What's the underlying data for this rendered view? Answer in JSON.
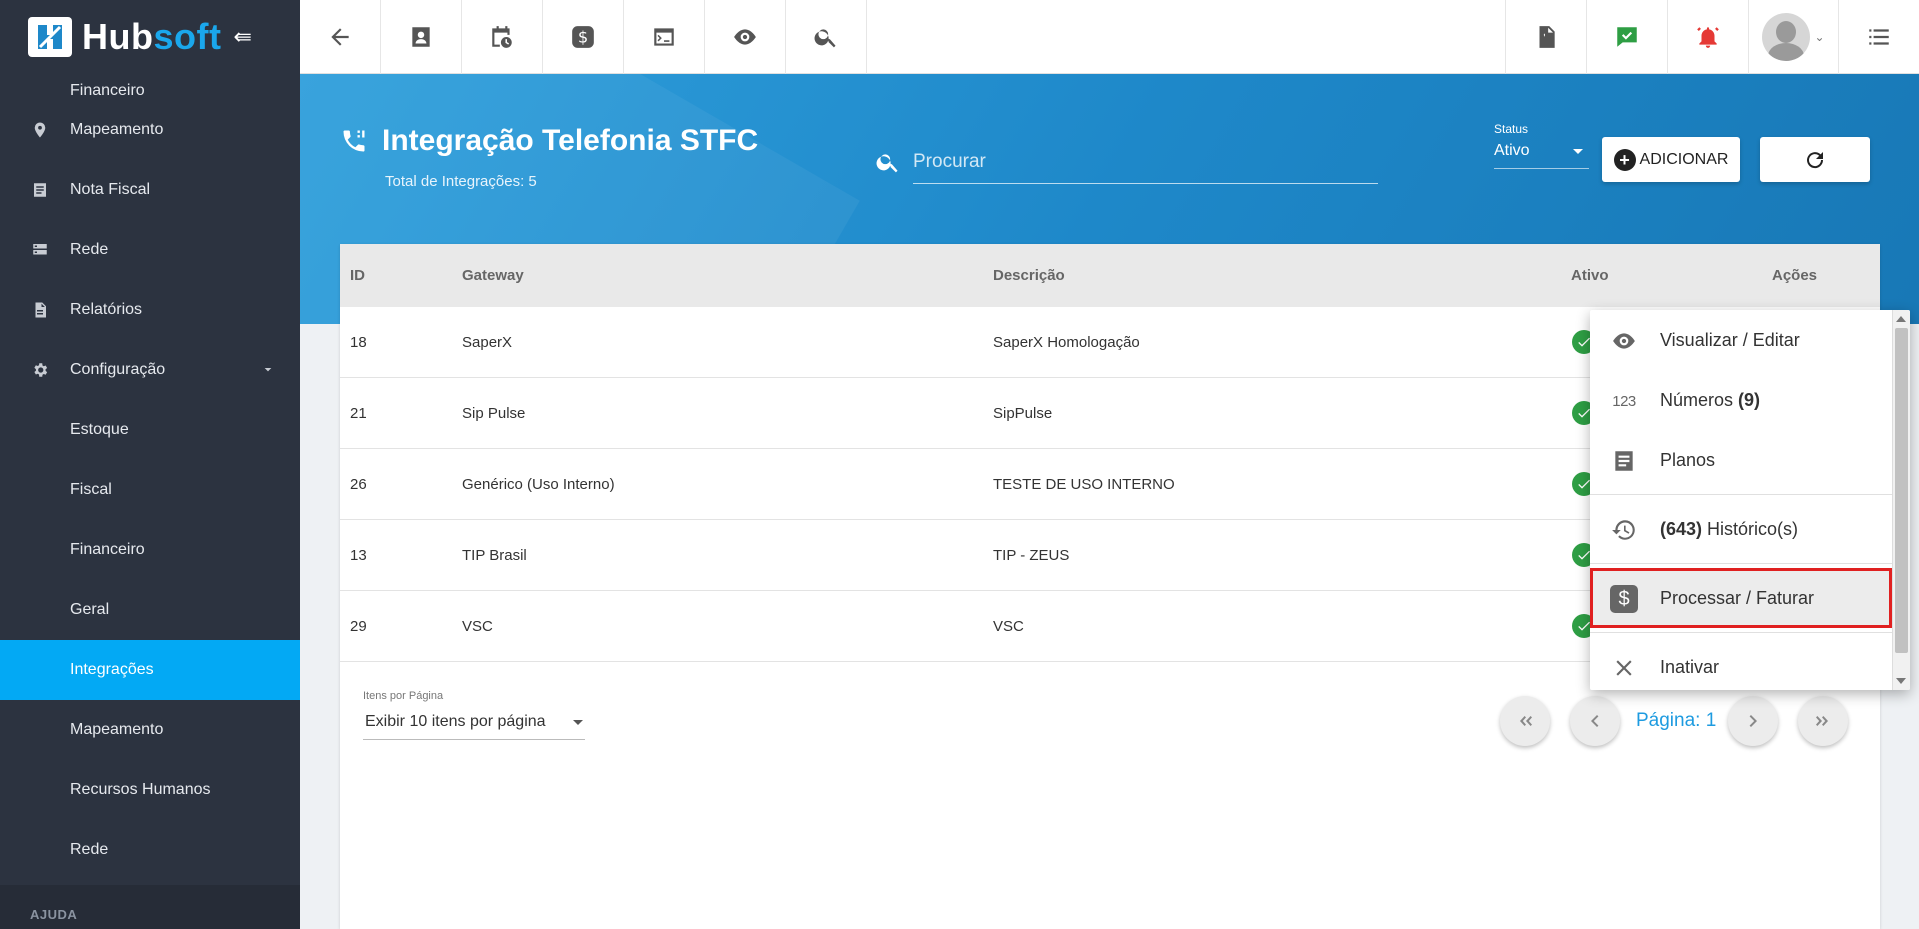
{
  "brand": {
    "name_a": "Hub",
    "name_b": "soft"
  },
  "sidebar": {
    "partial_item": "Financeiro",
    "items": [
      {
        "label": "Mapeamento",
        "icon": "map-pin-icon"
      },
      {
        "label": "Nota Fiscal",
        "icon": "receipt-icon"
      },
      {
        "label": "Rede",
        "icon": "server-icon"
      },
      {
        "label": "Relatórios",
        "icon": "document-icon"
      },
      {
        "label": "Configuração",
        "icon": "gear-icon"
      }
    ],
    "sub_items": [
      "Estoque",
      "Fiscal",
      "Financeiro",
      "Geral",
      "Integrações",
      "Mapeamento",
      "Recursos Humanos",
      "Rede"
    ],
    "active_sub": "Integrações",
    "section_label": "AJUDA"
  },
  "header": {
    "title": "Integração Telefonia STFC",
    "subtitle": "Total de Integrações: 5",
    "search_placeholder": "Procurar",
    "status_label": "Status",
    "status_value": "Ativo",
    "add_label": "ADICIONAR"
  },
  "table": {
    "columns": [
      "ID",
      "Gateway",
      "Descrição",
      "Ativo",
      "Ações"
    ],
    "rows": [
      {
        "id": "18",
        "gateway": "SaperX",
        "descricao": "SaperX Homologação",
        "ativo": true
      },
      {
        "id": "21",
        "gateway": "Sip Pulse",
        "descricao": "SipPulse",
        "ativo": true
      },
      {
        "id": "26",
        "gateway": "Genérico (Uso Interno)",
        "descricao": "TESTE DE USO INTERNO",
        "ativo": true
      },
      {
        "id": "13",
        "gateway": "TIP Brasil",
        "descricao": "TIP - ZEUS",
        "ativo": true
      },
      {
        "id": "29",
        "gateway": "VSC",
        "descricao": "VSC",
        "ativo": true
      }
    ]
  },
  "pagination": {
    "per_page_label": "Itens por Página",
    "per_page_value": "Exibir 10 itens por página",
    "page_label": "Página: 1"
  },
  "menu": {
    "view_edit": "Visualizar / Editar",
    "numeros_label": "Números",
    "numeros_count": "(9)",
    "planos": "Planos",
    "historico_count": "(643)",
    "historico_label": "Histórico(s)",
    "processar": "Processar / Faturar",
    "inativar": "Inativar"
  },
  "colors": {
    "accent": "#03a9f4",
    "sidebar": "#2c3340",
    "success": "#2e9e44",
    "highlight_border": "#e02020"
  }
}
